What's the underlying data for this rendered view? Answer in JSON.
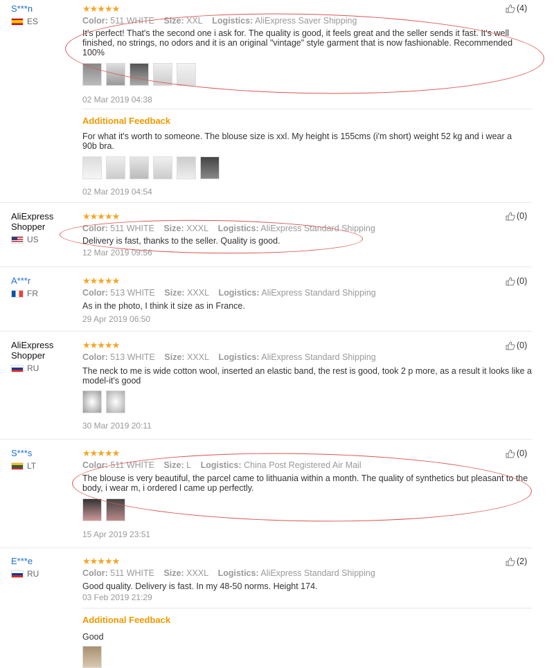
{
  "reviews": [
    {
      "user": "S***n",
      "country": "ES",
      "stars": "★★★★★",
      "color_label": "Color:",
      "color": "511 WHITE",
      "size_label": "Size:",
      "size": "XXL",
      "logistics_label": "Logistics:",
      "logistics": "AliExpress Saver Shipping",
      "text": "It's perfect! That's the second one i ask for. The quality is good, it feels great and the seller sends it fast. It's well finished, no strings, no odors and it is an original \"vintage\" style garment that is now fashionable. Recommended 100%",
      "date": "02 Mar 2019 04:38",
      "helpful": "(4)",
      "additional_label": "Additional Feedback",
      "additional_text": "For what it's worth to someone. The blouse size is xxl. My height is 155cms (i'm short) weight 52 kg and i wear a 90b bra.",
      "additional_date": "02 Mar 2019 04:54"
    },
    {
      "user": "AliExpress Shopper",
      "country": "US",
      "stars": "★★★★★",
      "color_label": "Color:",
      "color": "511 WHITE",
      "size_label": "Size:",
      "size": "XXXL",
      "logistics_label": "Logistics:",
      "logistics": "AliExpress Standard Shipping",
      "text": "Delivery is fast, thanks to the seller. Quality is good.",
      "date": "12 Mar 2019 09:56",
      "helpful": "(0)"
    },
    {
      "user": "A***r",
      "country": "FR",
      "stars": "★★★★★",
      "color_label": "Color:",
      "color": "513 WHITE",
      "size_label": "Size:",
      "size": "XXXL",
      "logistics_label": "Logistics:",
      "logistics": "AliExpress Standard Shipping",
      "text": "As in the photo, I think it size as in France.",
      "date": "29 Apr 2019 06:50",
      "helpful": "(0)"
    },
    {
      "user": "AliExpress Shopper",
      "country": "RU",
      "stars": "★★★★★",
      "color_label": "Color:",
      "color": "513 WHITE",
      "size_label": "Size:",
      "size": "XXXL",
      "logistics_label": "Logistics:",
      "logistics": "AliExpress Standard Shipping",
      "text": "The neck to me is wide cotton wool, inserted an elastic band, the rest is good, took 2 p more, as a result it looks like a model-it's good",
      "date": "30 Mar 2019 20:11",
      "helpful": "(0)"
    },
    {
      "user": "S***s",
      "country": "LT",
      "stars": "★★★★★",
      "color_label": "Color:",
      "color": "511 WHITE",
      "size_label": "Size:",
      "size": "L",
      "logistics_label": "Logistics:",
      "logistics": "China Post Registered Air Mail",
      "text": "The blouse is very beautiful, the parcel came to lithuania within a month. The quality of synthetics but pleasant to the body, i wear m, i ordered l came up perfectly.",
      "date": "15 Apr 2019 23:51",
      "helpful": "(0)"
    },
    {
      "user": "E***e",
      "country": "RU",
      "stars": "★★★★★",
      "color_label": "Color:",
      "color": "511 WHITE",
      "size_label": "Size:",
      "size": "XXXL",
      "logistics_label": "Logistics:",
      "logistics": "AliExpress Standard Shipping",
      "text": "Good quality. Delivery is fast. In my 48-50 norms. Height 174.",
      "date": "03 Feb 2019 21:29",
      "helpful": "(2)",
      "additional_label": "Additional Feedback",
      "additional_text": "Good"
    }
  ],
  "icons": {
    "helpful": "thumbs-up-icon",
    "rating": "star-icon"
  },
  "colors": {
    "accent": "#f29900",
    "username": "#1e6fd0",
    "annotation": "#d9534f"
  }
}
